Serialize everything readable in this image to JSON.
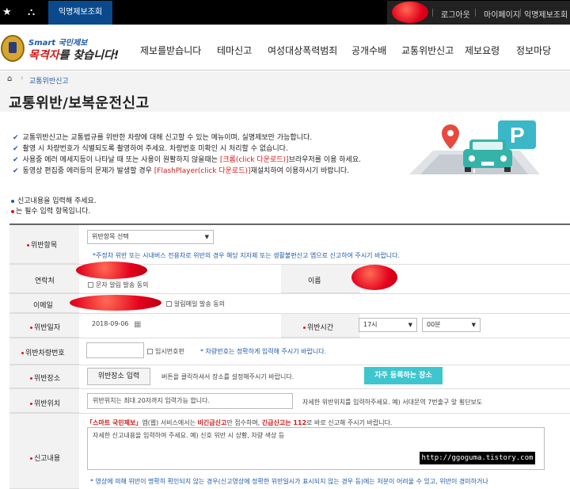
{
  "topbar": {
    "tab_label": "익명제보조회",
    "logout": "로그아웃",
    "mypage": "마이페이지",
    "anon_lookup": "익명제보조회"
  },
  "header": {
    "logo_smart": "Smart 국민제보",
    "logo_main_red": "목격자",
    "logo_main_rest": "를 찾습니다!",
    "nav": [
      "제보를받습니다",
      "테마신고",
      "여성대상폭력범죄",
      "공개수배",
      "교통위반신고",
      "제보요령",
      "정보마당"
    ]
  },
  "breadcrumb": {
    "current": "교통위반신고"
  },
  "page_title": "교통위반/보복운전신고",
  "notices": [
    {
      "pre": "교통위반신고는 교통법규를 위반한 차량에 대해 신고할 수 있는 메뉴이며, 실명제보만 가능합니다.",
      "hl": "",
      "post": ""
    },
    {
      "pre": "촬영 시 차량번호가 식별되도록 촬영하여 주세요. 차량번호 미확인 시 처리할 수 없습니다.",
      "hl": "",
      "post": ""
    },
    {
      "pre": "사용중 에러 메세지등이 나타날 때 또는 사용이 원활하지 않을때는 ",
      "hl": "[크롬(click 다운로드)]",
      "post": "브라우저를 이용 하세요."
    },
    {
      "pre": "동영상 편집중 에러등의 문제가 발생할 경우 ",
      "hl": "[FlashPlayer(click 다운로드)]",
      "post": "재설치하여 이용하시기 바랍니다."
    }
  ],
  "guide": {
    "enter_report": "신고내용을 입력해 주세요.",
    "required_note": "는 필수 입력 항목입니다."
  },
  "form": {
    "violation_item": {
      "label": "위반항목",
      "select_value": "위반항목 선택",
      "note": "*주정차 위반 또는 시내버스 전용차로 위반의 경우 해당 지자체 또는 생활불편신고 앱으로 신고하여 주시기 바랍니다."
    },
    "contact": {
      "label": "연락처",
      "sms_opt": "문자 알림 발송 동의"
    },
    "name": {
      "label": "이름"
    },
    "email": {
      "label": "이메일",
      "mail_opt": "알림메일 발송 동의"
    },
    "violation_date": {
      "label": "위반일자",
      "value": "2018-09-06"
    },
    "violation_time": {
      "label": "위반시간",
      "hour": "17시",
      "minute": "00분"
    },
    "plate": {
      "label": "위반차량번호",
      "temp_opt": "임시번호판",
      "note": "* 차량번호는 정확하게 입력해 주시기 바랍니다."
    },
    "place": {
      "label": "위반장소",
      "button": "위반장소 입력",
      "hint": "버튼을 클릭하셔서 장소를 설정해주시기 바랍니다.",
      "frequent": "자주 등록하는 장소"
    },
    "location": {
      "label": "위반위치",
      "placeholder": "위반위치는 최대 20자까지 입력가능 합니다.",
      "hint": "자세한 위반위치를 입력하주세요. 예) 서대문역 7번출구 앞 횡단보도"
    },
    "content": {
      "label": "신고내용",
      "line1_a": "「스마트 국민제보」",
      "line1_b": "앱(웹) 서비스에서는 ",
      "line1_c": "비긴급신고",
      "line1_d": "만 접수하며, ",
      "line1_e": "긴급신고는 112",
      "line1_f": "로 바로 신고해 주시기 바랍니다.",
      "placeholder": "자세한 신고내용을 입력하여 주세요. 예) 신호 위반 시 상황, 차량 색상 등",
      "footer_note": "* 영상에 의해 위반이 명확히 확인되지 않는 경우(신고영상에 정확한 위반일시가 표시되지 않는 경우 등)에는 처분이 어려울 수 있고, 위반이 경미하거나"
    }
  },
  "watermark": "http://ggoguma.tistory.com",
  "colors": {
    "brand_blue": "#0a4a8c",
    "accent_red": "#d21a1a",
    "teal": "#3ec6cf"
  }
}
